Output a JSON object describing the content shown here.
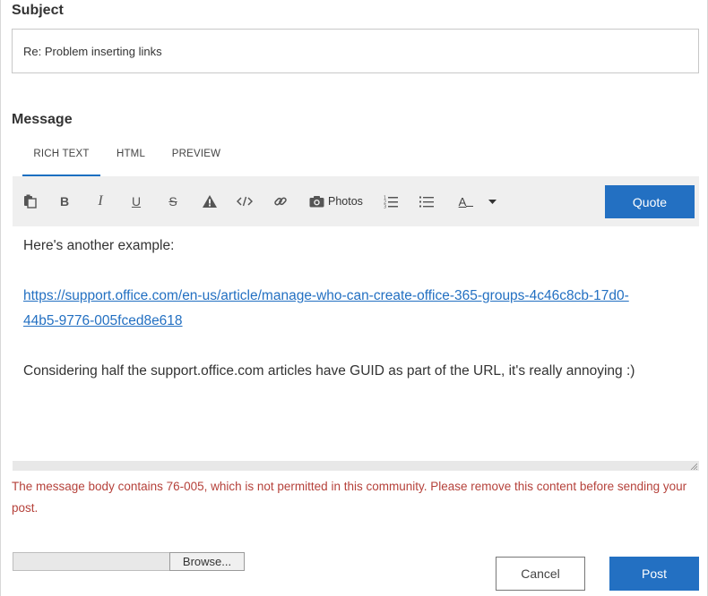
{
  "subject": {
    "label": "Subject",
    "value": "Re: Problem inserting links"
  },
  "message": {
    "label": "Message",
    "tabs": [
      {
        "label": "RICH TEXT",
        "active": true
      },
      {
        "label": "HTML",
        "active": false
      },
      {
        "label": "PREVIEW",
        "active": false
      }
    ]
  },
  "toolbar": {
    "icons": [
      "paste-icon",
      "bold-icon",
      "italic-icon",
      "underline-icon",
      "strikethrough-icon",
      "spoiler-icon",
      "code-icon",
      "link-icon",
      "camera-icon",
      "numbered-list-icon",
      "bulleted-list-icon",
      "text-color-icon",
      "dropdown-caret-icon"
    ],
    "bold_label": "B",
    "italic_label": "I",
    "underline_label": "U",
    "strike_label": "S",
    "photos_label": "Photos",
    "font_color_label": "A",
    "quote_label": "Quote"
  },
  "body": {
    "intro": "Here's another example:",
    "link_line1": "https://support.office.com/en-us/article/manage-who-can-create-office-365-groups-4c46c8cb-17d0-",
    "link_line2": "44b5-9776-005fced8e618",
    "closing": "Considering half the support.office.com articles have GUID as part of the URL, it's really annoying :)"
  },
  "error_message": "The message body contains 76-005, which is not permitted in this community. Please remove this content before sending your post.",
  "attachment": {
    "browse_label": "Browse..."
  },
  "actions": {
    "cancel_label": "Cancel",
    "post_label": "Post"
  },
  "colors": {
    "accent": "#2370c2",
    "error": "#b5413a",
    "toolbar_bg": "#efefef"
  }
}
